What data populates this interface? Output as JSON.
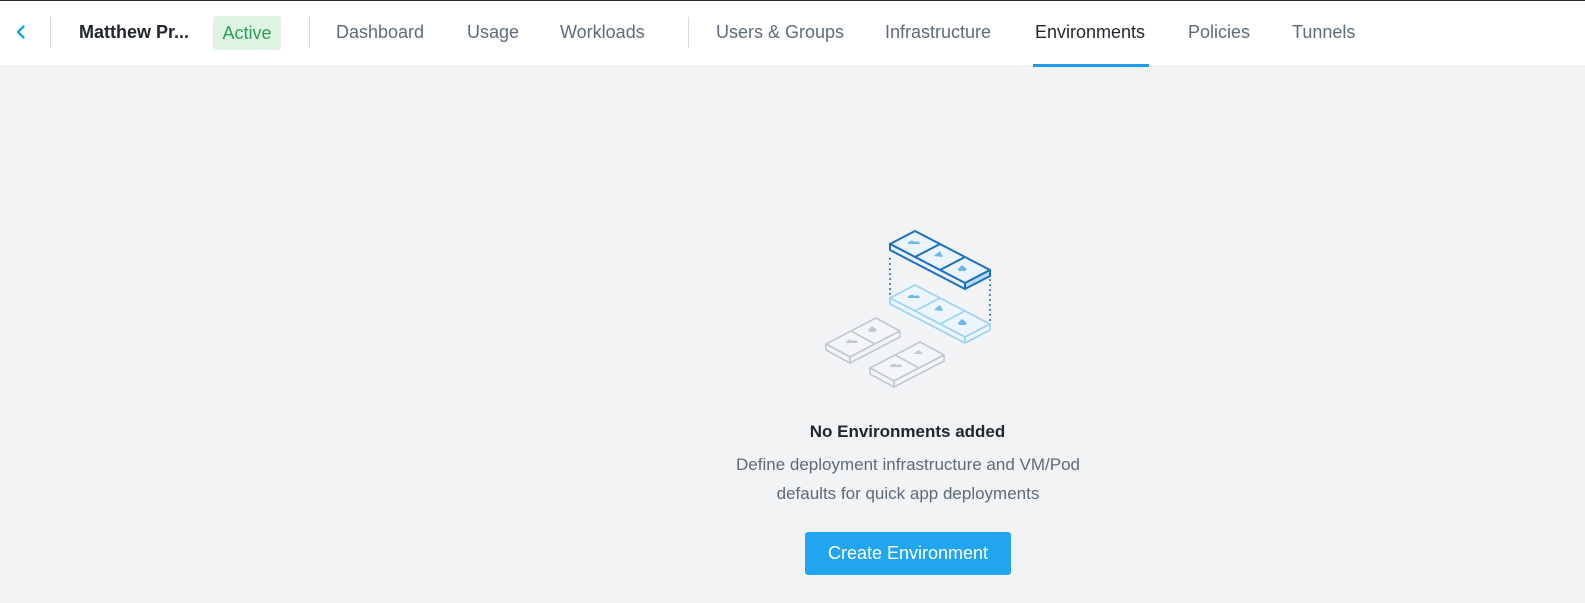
{
  "header": {
    "back_icon": "chevron-left-icon",
    "project_name": "Matthew Pr...",
    "status": "Active",
    "colors": {
      "accent": "#1f9bef",
      "status_bg": "#dff3e4",
      "status_text": "#2e9e52"
    },
    "tabs": [
      {
        "label": "Dashboard",
        "active": false
      },
      {
        "label": "Usage",
        "active": false
      },
      {
        "label": "Workloads",
        "active": false
      },
      {
        "label": "Users & Groups",
        "active": false
      },
      {
        "label": "Infrastructure",
        "active": false
      },
      {
        "label": "Environments",
        "active": true
      },
      {
        "label": "Policies",
        "active": false
      },
      {
        "label": "Tunnels",
        "active": false
      }
    ]
  },
  "empty_state": {
    "illustration": "stacked-environments-illustration",
    "title": "No Environments added",
    "description_line1": "Define deployment infrastructure and VM/Pod",
    "description_line2": "defaults for quick app deployments",
    "button_label": "Create Environment",
    "button_color": "#22a5f1"
  }
}
